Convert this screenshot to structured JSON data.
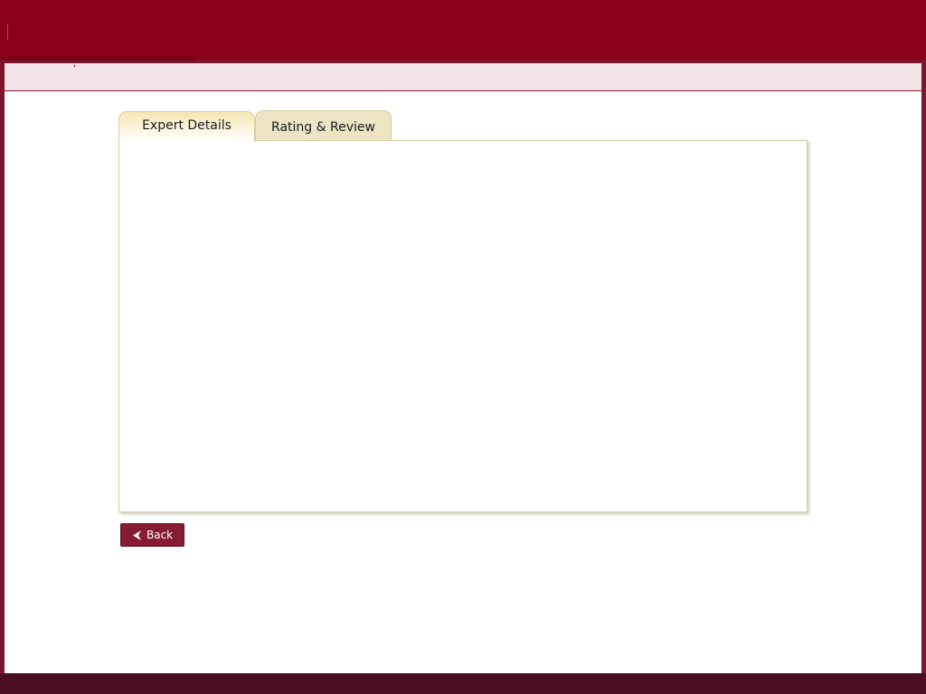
{
  "tabs": [
    {
      "label": "Expert Details",
      "active": true
    },
    {
      "label": "Rating & Review",
      "active": false
    }
  ],
  "actions": {
    "back_label": "Back"
  },
  "icons": {
    "back": "chevron-left-icon"
  },
  "colors": {
    "brand": "#8a0019",
    "frame": "#7d1530",
    "sub_header": "#f2e4e6",
    "tab_border": "#d6cf9c",
    "button": "#861b32"
  }
}
